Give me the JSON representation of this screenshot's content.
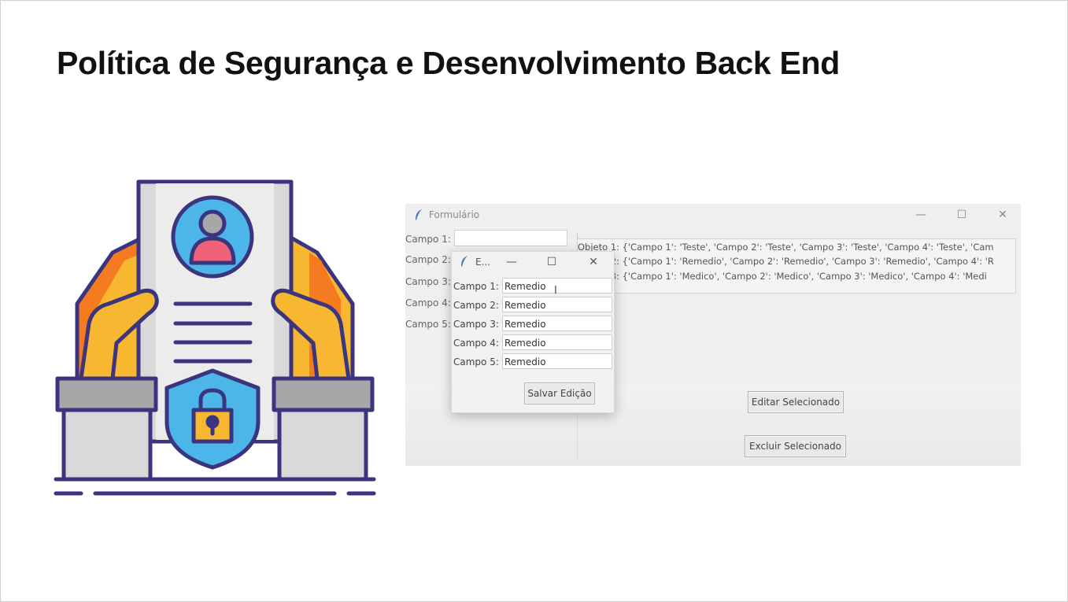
{
  "slide": {
    "title": "Política de Segurança e Desenvolvimento Back End"
  },
  "app": {
    "window_title": "Formulário",
    "minimize_glyph": "—",
    "maximize_glyph": "☐",
    "close_glyph": "✕",
    "main_form": {
      "labels": [
        "Campo 1:",
        "Campo 2:",
        "Campo 3:",
        "Campo 4:",
        "Campo 5:"
      ],
      "campo1_value": ""
    },
    "list_items": [
      "Objeto 1: {'Campo 1': 'Teste', 'Campo 2': 'Teste', 'Campo 3': 'Teste', 'Campo 4': 'Teste', 'Cam",
      "Objeto 2: {'Campo 1': 'Remedio', 'Campo 2': 'Remedio', 'Campo 3': 'Remedio', 'Campo 4': 'R",
      "Objeto 3: {'Campo 1': 'Medico', 'Campo 2': 'Medico', 'Campo 3': 'Medico', 'Campo 4': 'Medi"
    ],
    "edit_button": "Editar Selecionado",
    "delete_button": "Excluir Selecionado",
    "dialog": {
      "title": "E...",
      "fields": [
        {
          "label": "Campo 1:",
          "value": "Remedio"
        },
        {
          "label": "Campo 2:",
          "value": "Remedio"
        },
        {
          "label": "Campo 3:",
          "value": "Remedio"
        },
        {
          "label": "Campo 4:",
          "value": "Remedio"
        },
        {
          "label": "Campo 5:",
          "value": "Remedio"
        }
      ],
      "save_button": "Salvar Edição"
    }
  },
  "colors": {
    "illustration_outline": "#3b3580",
    "orange": "#f47b20",
    "yellow": "#f7b731",
    "blue": "#4db6e8",
    "pink": "#f06277",
    "gray_light": "#d9d9d9",
    "gray_dark": "#a7a7a7"
  },
  "icons": {
    "illustration": "security-document-hands-illustration",
    "app_icon": "feather-icon"
  }
}
